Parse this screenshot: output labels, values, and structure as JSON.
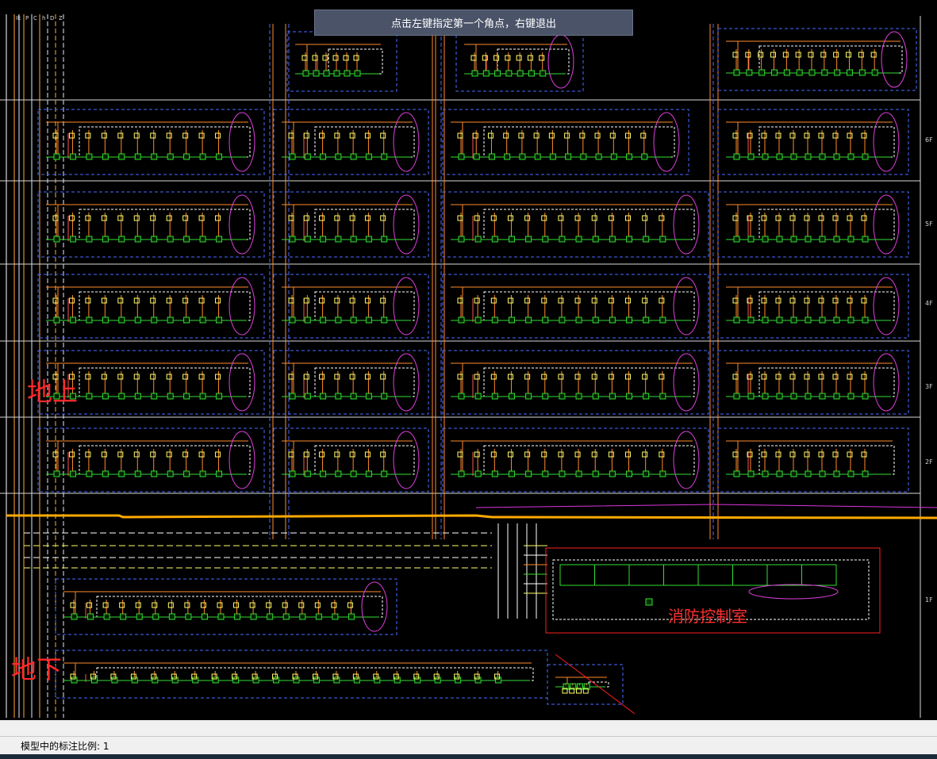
{
  "command_prompt": "点击左键指定第一个角点，右键退出",
  "labels": {
    "above_ground": "地上",
    "below_ground": "地下"
  },
  "control_room": {
    "title": "消防控制室"
  },
  "floors": [
    "6F",
    "5F",
    "4F",
    "3F",
    "2F",
    "1F"
  ],
  "bus_headers": [
    "Ik",
    "P",
    "C",
    "h",
    "D",
    "Z"
  ],
  "status_bar": {
    "annotation_scale": "模型中的标注比例: 1"
  },
  "colors": {
    "background": "#000000",
    "dashed_frame": "#4a6bff",
    "wire_orange": "#ff8a2a",
    "device_green": "#33dd33",
    "cloud_magenta": "#e040e0",
    "highlight_red": "#ff2020",
    "floor_line": "#ffaa00",
    "prompt_bg": "#4a5368"
  }
}
